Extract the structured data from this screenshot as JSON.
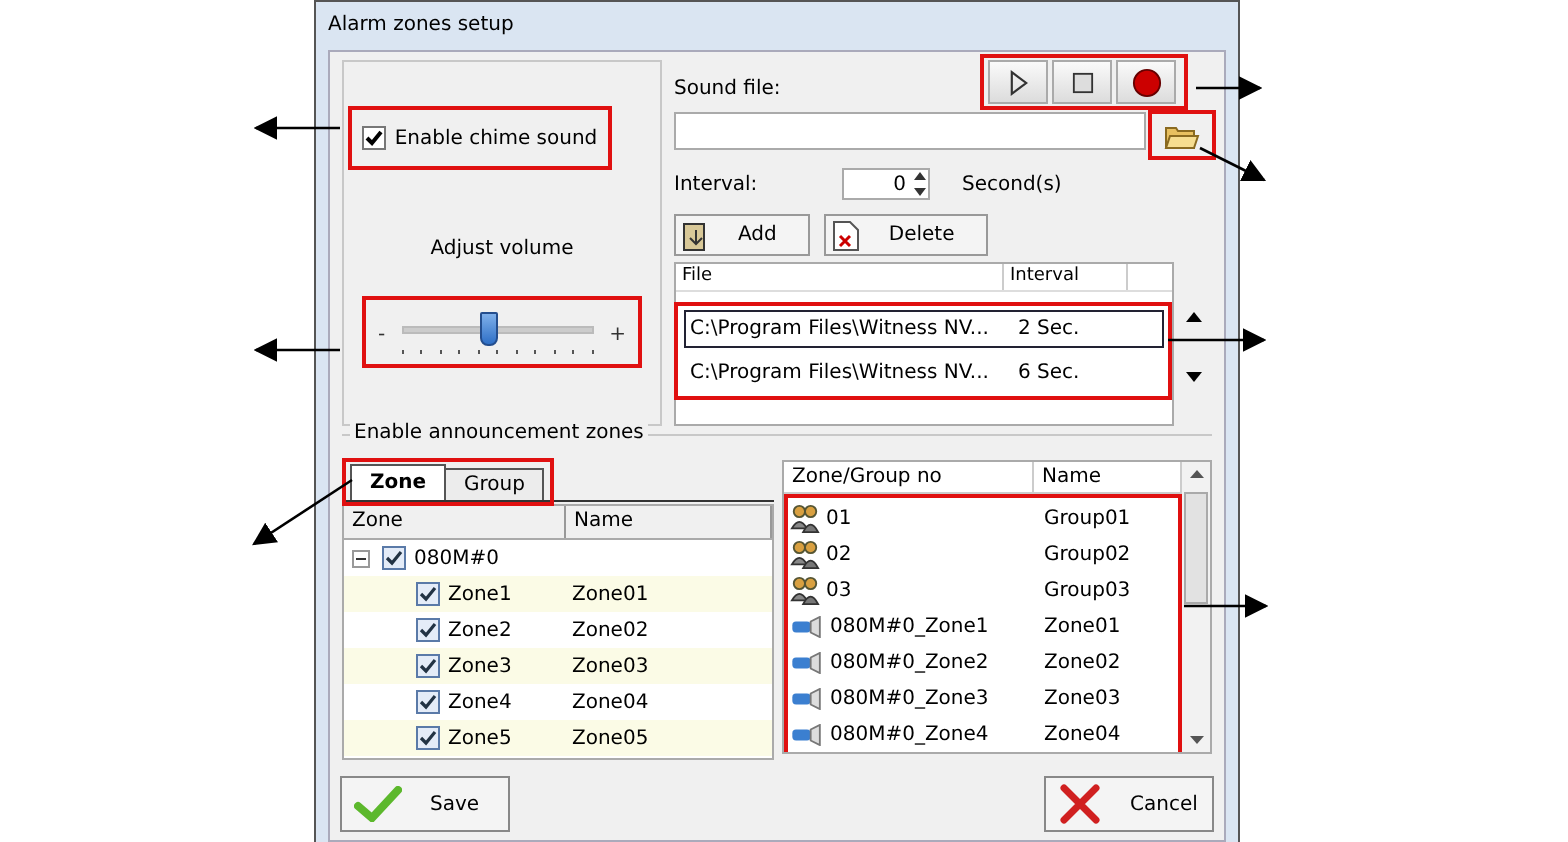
{
  "window": {
    "title": "Alarm zones setup"
  },
  "chime": {
    "label": "Enable chime sound",
    "checked": true
  },
  "volume": {
    "label": "Adjust volume",
    "min_label": "-",
    "max_label": "+",
    "level": 0.45
  },
  "sound_file": {
    "label": "Sound file:"
  },
  "interval": {
    "label": "Interval:",
    "value": "0",
    "unit": "Second(s)"
  },
  "file_buttons": [
    {
      "label": "Add",
      "kind": "add"
    },
    {
      "label": "Delete",
      "kind": "delete"
    }
  ],
  "file_list": {
    "columns": [
      "File",
      "Interval"
    ],
    "rows": [
      {
        "file": "C:\\Program Files\\Witness NV...",
        "interval": "2 Sec.",
        "selected": true
      },
      {
        "file": "C:\\Program Files\\Witness NV...",
        "interval": "6 Sec.",
        "selected": false
      }
    ]
  },
  "zones_group": {
    "title": "Enable announcement zones",
    "tabs": [
      {
        "label": "Zone",
        "selected": true
      },
      {
        "label": "Group",
        "selected": false
      }
    ],
    "tree": {
      "columns": [
        "Zone",
        "Name"
      ],
      "items": [
        {
          "zone": "080M#0",
          "checked": true,
          "expanded": true,
          "children": [
            {
              "zone": "Zone1",
              "name": "Zone01",
              "checked": true
            },
            {
              "zone": "Zone2",
              "name": "Zone02",
              "checked": true
            },
            {
              "zone": "Zone3",
              "name": "Zone03",
              "checked": true
            },
            {
              "zone": "Zone4",
              "name": "Zone04",
              "checked": true
            },
            {
              "zone": "Zone5",
              "name": "Zone05",
              "checked": true
            }
          ]
        }
      ]
    }
  },
  "zone_list": {
    "columns": [
      "Zone/Group no",
      "Name"
    ],
    "rows": [
      {
        "kind": "group",
        "number": "01",
        "name": "Group01"
      },
      {
        "kind": "group",
        "number": "02",
        "name": "Group02"
      },
      {
        "kind": "group",
        "number": "03",
        "name": "Group03"
      },
      {
        "kind": "zone",
        "number": "080M#0_Zone1",
        "name": "Zone01"
      },
      {
        "kind": "zone",
        "number": "080M#0_Zone2",
        "name": "Zone02"
      },
      {
        "kind": "zone",
        "number": "080M#0_Zone3",
        "name": "Zone03"
      },
      {
        "kind": "zone",
        "number": "080M#0_Zone4",
        "name": "Zone04"
      }
    ]
  },
  "buttons": [
    {
      "label": "Save",
      "kind": "save"
    },
    {
      "label": "Cancel",
      "kind": "cancel"
    }
  ]
}
